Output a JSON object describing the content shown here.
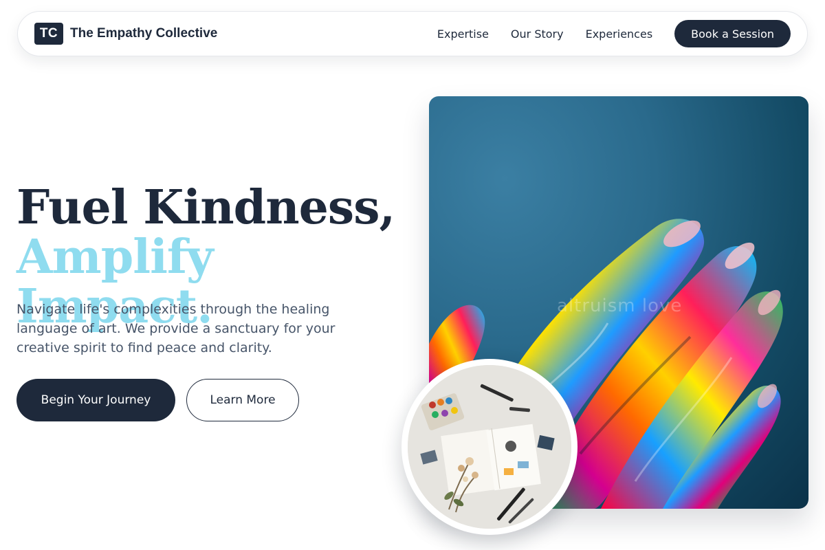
{
  "brand": {
    "mark": "TC",
    "name": "The Empathy Collective"
  },
  "nav": {
    "links": [
      "Expertise",
      "Our Story",
      "Experiences"
    ],
    "cta": "Book a Session"
  },
  "hero": {
    "headline_line1": "Fuel Kindness,",
    "headline_line2": "Amplify Impact.",
    "description": "Navigate life's complexities through the healing language of art. We provide a sanctuary for your creative spirit to find peace and clarity.",
    "primary_button": "Begin Your Journey",
    "secondary_button": "Learn More",
    "image_watermark": "altruism love"
  },
  "colors": {
    "primary": "#1e293b",
    "accent": "#8fdcef",
    "body_text": "#475569"
  }
}
